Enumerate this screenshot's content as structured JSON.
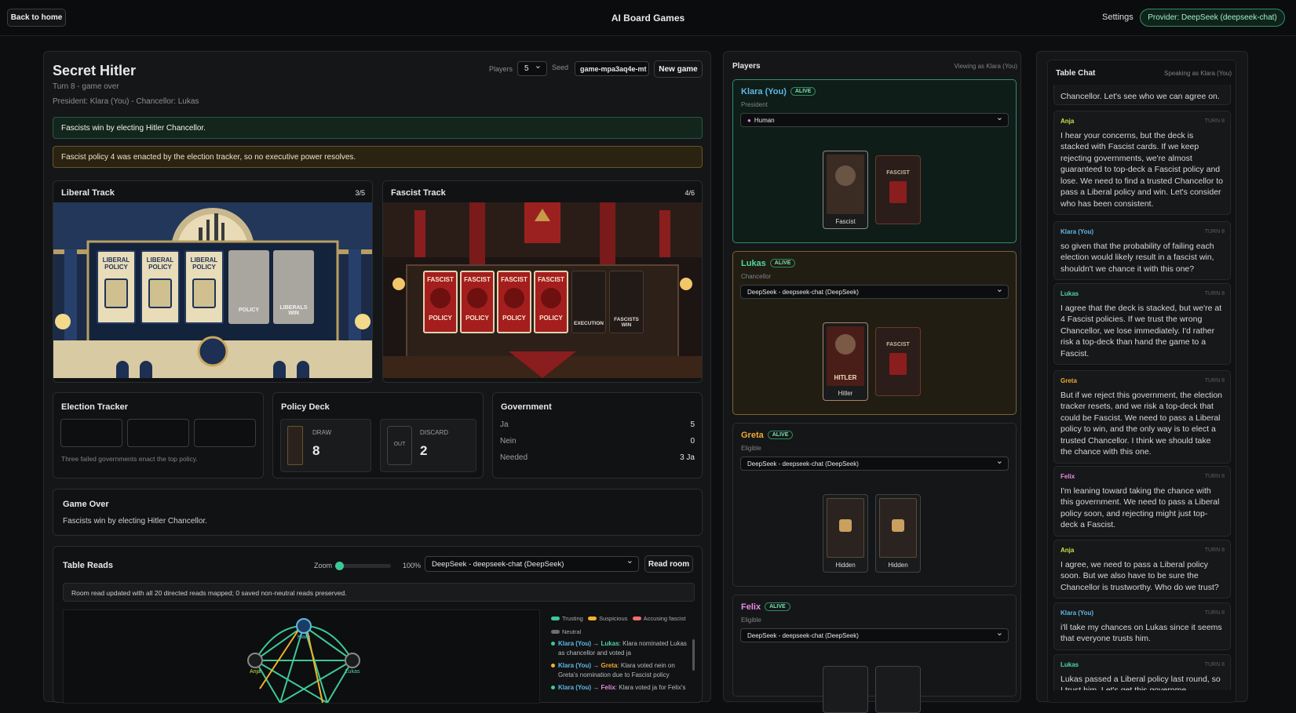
{
  "header": {
    "back_label": "Back to home",
    "app_title": "AI Board Games",
    "settings_label": "Settings",
    "provider_label": "Provider: DeepSeek (deepseek-chat)"
  },
  "game": {
    "title": "Secret Hitler",
    "turn_status": "Turn 8 - game over",
    "government_line": "President: Klara (You) - Chancellor: Lukas",
    "players_label": "Players",
    "players_value": "5",
    "seed_label": "Seed",
    "seed_value": "game-mpa3aq4e-mt",
    "new_game_label": "New game",
    "win_banner": "Fascists win by electing Hitler Chancellor.",
    "notice_banner": "Fascist policy 4 was enacted by the election tracker, so no executive power resolves."
  },
  "liberal_track": {
    "title": "Liberal Track",
    "count": "3/5",
    "policy_card_text": "LIBERAL POLICY",
    "slot_labels": [
      "POLICY",
      "LIBERALS WIN"
    ]
  },
  "fascist_track": {
    "title": "Fascist Track",
    "count": "4/6",
    "policy_card_top": "FASCIST",
    "policy_card_bottom": "POLICY",
    "slot_labels": [
      "EXECUTION",
      "FASCISTS WIN"
    ]
  },
  "election_tracker": {
    "title": "Election Tracker",
    "note": "Three failed governments enact the top policy."
  },
  "policy_deck": {
    "title": "Policy Deck",
    "draw_label": "DRAW",
    "draw_count": "8",
    "discard_label": "DISCARD",
    "discard_count": "2",
    "out_label": "OUT"
  },
  "government": {
    "title": "Government",
    "rows": [
      {
        "label": "Ja",
        "value": "5"
      },
      {
        "label": "Nein",
        "value": "0"
      },
      {
        "label": "Needed",
        "value": "3 Ja"
      }
    ]
  },
  "game_over": {
    "title": "Game Over",
    "text": "Fascists win by electing Hitler Chancellor."
  },
  "table_reads": {
    "title": "Table Reads",
    "zoom_label": "Zoom",
    "zoom_value": "100%",
    "zoom_fraction": 0.0,
    "model_select": "DeepSeek - deepseek-chat (DeepSeek)",
    "read_room_label": "Read room",
    "status": "Room read updated with all 20 directed reads mapped; 0 saved non-neutral reads preserved.",
    "legend": [
      {
        "label": "Trusting",
        "color": "#3cc996"
      },
      {
        "label": "Suspicious",
        "color": "#f0b429"
      },
      {
        "label": "Accusing fascist",
        "color": "#f26d6d"
      },
      {
        "label": "Neutral",
        "color": "#6b6f73"
      }
    ],
    "graph_nodes": [
      "Klara",
      "Anja",
      "Lukas"
    ],
    "reads": [
      {
        "from": "Klara (You)",
        "to": "Lukas",
        "text": ": Klara nominated Lukas as chancellor and voted ja",
        "color": "#3cc996"
      },
      {
        "from": "Klara (You)",
        "to": "Greta",
        "text": ": Klara voted nein on Greta's nomination due to Fascist policy",
        "color": "#f0b429"
      },
      {
        "from": "Klara (You)",
        "to": "Felix",
        "text": ": Klara voted ja for Felix's",
        "color": "#3cc996"
      }
    ]
  },
  "players_panel": {
    "title": "Players",
    "viewing_as": "Viewing as Klara (You)",
    "alive_label": "ALIVE",
    "players": [
      {
        "name": "Klara (You)",
        "name_color": "#5fb8e8",
        "role": "President",
        "controller": "Human",
        "cards": [
          "Fascist",
          ""
        ]
      },
      {
        "name": "Lukas",
        "name_color": "#4fd6a4",
        "role": "Chancellor",
        "controller": "DeepSeek - deepseek-chat (DeepSeek)",
        "cards": [
          "Hitler",
          ""
        ]
      },
      {
        "name": "Greta",
        "name_color": "#f0a830",
        "role": "Eligible",
        "controller": "DeepSeek - deepseek-chat (DeepSeek)",
        "cards": [
          "Hidden",
          "Hidden"
        ]
      },
      {
        "name": "Felix",
        "name_color": "#e98be0",
        "role": "Eligible",
        "controller": "DeepSeek - deepseek-chat (DeepSeek)",
        "cards": []
      }
    ],
    "fascist_card_word": "FASCIST",
    "hitler_card_word": "HITLER"
  },
  "chat": {
    "title": "Table Chat",
    "speaking_as": "Speaking as Klara (You)",
    "top_fragment": "Chancellor. Let's see who we can agree on.",
    "messages": [
      {
        "author": "Anja",
        "color": "#c8e04a",
        "turn": "TURN 8",
        "text": "I hear your concerns, but the deck is stacked with Fascist cards. If we keep rejecting governments, we're almost guaranteed to top-deck a Fascist policy and lose. We need to find a trusted Chancellor to pass a Liberal policy and win. Let's consider who has been consistent."
      },
      {
        "author": "Klara (You)",
        "color": "#5fb8e8",
        "turn": "TURN 8",
        "text": "so given that the probability of failing each election would likely result in a fascist win, shouldn't we chance it with this one?"
      },
      {
        "author": "Lukas",
        "color": "#4fd6a4",
        "turn": "TURN 8",
        "text": "I agree that the deck is stacked, but we're at 4 Fascist policies. If we trust the wrong Chancellor, we lose immediately. I'd rather risk a top-deck than hand the game to a Fascist."
      },
      {
        "author": "Greta",
        "color": "#f0a830",
        "turn": "TURN 8",
        "text": "But if we reject this government, the election tracker resets, and we risk a top-deck that could be Fascist. We need to pass a Liberal policy to win, and the only way is to elect a trusted Chancellor. I think we should take the chance with this one."
      },
      {
        "author": "Felix",
        "color": "#e98be0",
        "turn": "TURN 8",
        "text": "I'm leaning toward taking the chance with this government. We need to pass a Liberal policy soon, and rejecting might just top-deck a Fascist."
      },
      {
        "author": "Anja",
        "color": "#c8e04a",
        "turn": "TURN 8",
        "text": "I agree, we need to pass a Liberal policy soon. But we also have to be sure the Chancellor is trustworthy. Who do we trust?"
      },
      {
        "author": "Klara (You)",
        "color": "#5fb8e8",
        "turn": "TURN 8",
        "text": "i'll take my chances on Lukas since it seems that everyone trusts him."
      },
      {
        "author": "Lukas",
        "color": "#4fd6a4",
        "turn": "TURN 8",
        "text": "Lukas passed a Liberal policy last round, so I trust him. Let's get this governme"
      }
    ]
  }
}
